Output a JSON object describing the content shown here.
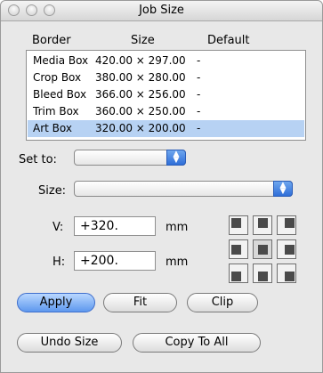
{
  "window": {
    "title": "Job Size"
  },
  "table": {
    "headers": [
      "Border",
      "Size",
      "Default"
    ],
    "rows": [
      {
        "border": "Media Box",
        "size": "420.00 × 297.00",
        "default": "-"
      },
      {
        "border": "Crop Box",
        "size": "380.00 × 280.00",
        "default": "-"
      },
      {
        "border": "Bleed Box",
        "size": "366.00 × 256.00",
        "default": "-"
      },
      {
        "border": "Trim Box",
        "size": "360.00 × 250.00",
        "default": "-"
      },
      {
        "border": "Art Box",
        "size": "320.00 × 200.00",
        "default": "-"
      }
    ],
    "selected_row": "Art Box"
  },
  "controls": {
    "set_to_label": "Set to:",
    "set_to_value": "",
    "size_label": "Size:",
    "size_value": "",
    "v_label": "V:",
    "v_value": "+320.",
    "h_label": "H:",
    "h_value": "+200.",
    "unit": "mm"
  },
  "anchor_grid": {
    "icons": [
      "top-left",
      "top-center",
      "top-right",
      "middle-left",
      "center",
      "middle-right",
      "bottom-left",
      "bottom-center",
      "bottom-right"
    ],
    "selected": "center"
  },
  "buttons": {
    "apply": "Apply",
    "fit": "Fit",
    "clip": "Clip",
    "undo_size": "Undo Size",
    "copy_to_all": "Copy To All"
  }
}
